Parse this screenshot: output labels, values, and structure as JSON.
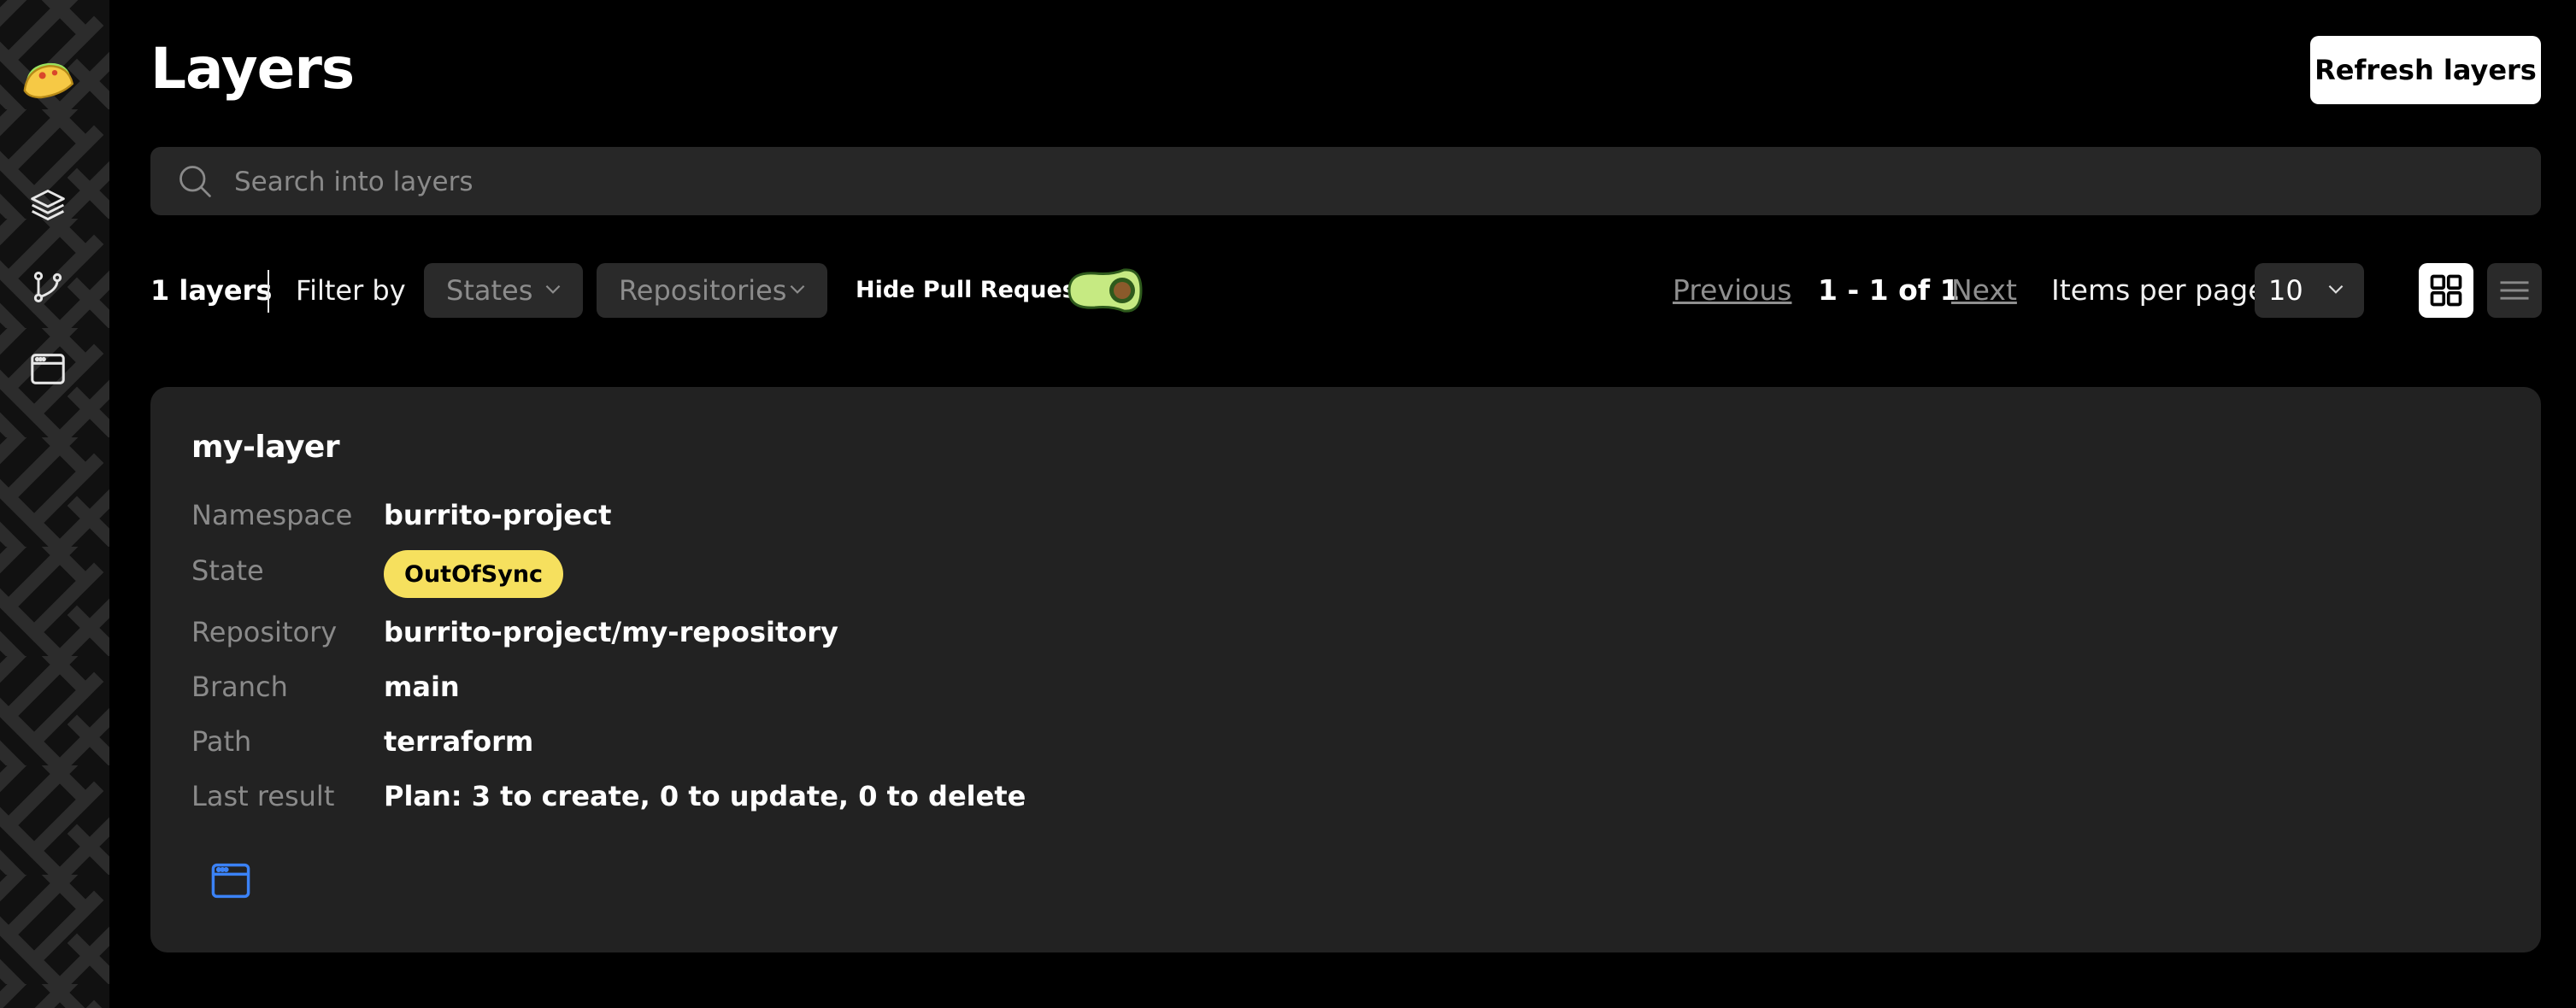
{
  "header": {
    "title": "Layers",
    "refresh_label": "Refresh layers"
  },
  "search": {
    "placeholder": "Search into layers",
    "value": ""
  },
  "toolbar": {
    "count_label": "1 layers",
    "filter_label": "Filter by",
    "states_select": "States",
    "repositories_select": "Repositories",
    "hide_pr_label": "Hide Pull Requests",
    "hide_pr_enabled": true
  },
  "pagination": {
    "previous_label": "Previous",
    "range_label": "1 - 1 of 1",
    "next_label": "Next",
    "items_per_page_label": "Items per page:",
    "items_per_page_value": "10"
  },
  "view_mode": "grid",
  "sidebar": {
    "items": [
      {
        "icon": "taco-logo-icon"
      },
      {
        "icon": "layers-icon"
      },
      {
        "icon": "git-branch-icon"
      },
      {
        "icon": "browser-window-icon"
      }
    ]
  },
  "layer": {
    "name": "my-layer",
    "fields": [
      {
        "label": "Namespace",
        "value": "burrito-project"
      },
      {
        "label": "State",
        "value": "OutOfSync"
      },
      {
        "label": "Repository",
        "value": "burrito-project/my-repository"
      },
      {
        "label": "Branch",
        "value": "main"
      },
      {
        "label": "Path",
        "value": "terraform"
      },
      {
        "label": "Last result",
        "value": "Plan: 3 to create, 0 to update, 0 to delete"
      }
    ],
    "state_color": "#f6e05e",
    "action_icon": "browser-window-icon"
  },
  "colors": {
    "accent_blue": "#3b82f6",
    "toggle_green": "#c6ea82",
    "background": "#000000",
    "card": "#222222"
  }
}
